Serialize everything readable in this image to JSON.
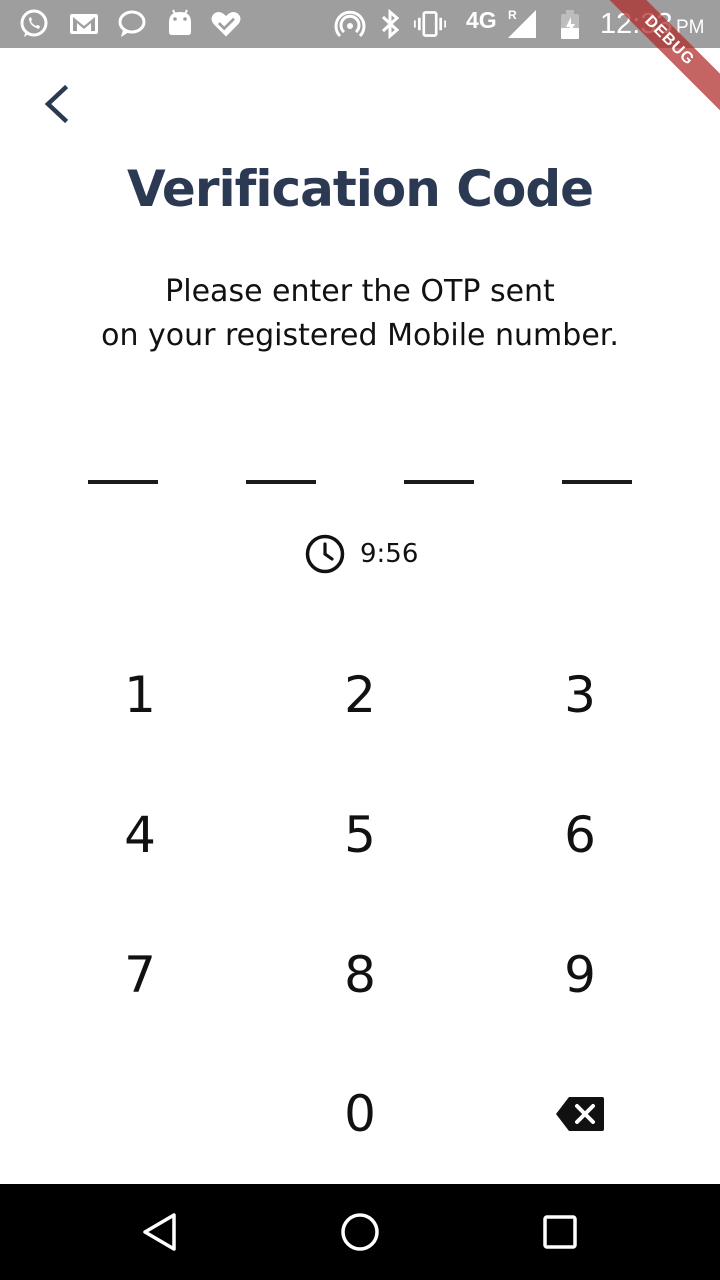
{
  "status_bar": {
    "network": "4G",
    "roaming": "R",
    "time": "12:33",
    "ampm": "PM",
    "debug_banner": "DEBUG",
    "icons": [
      "whatsapp-icon",
      "gmail-icon",
      "chat-bubble-icon",
      "android-icon",
      "heart-check-icon",
      "hotspot-icon",
      "bluetooth-icon",
      "vibrate-icon",
      "signal-icon",
      "battery-icon"
    ],
    "bar_color": "#9e9e9e"
  },
  "header": {
    "back_icon": "chevron-left-icon",
    "title": "Verification Code",
    "title_color": "#2b3a52"
  },
  "instructions": {
    "line1": "Please enter the OTP sent",
    "line2": "on your registered Mobile number."
  },
  "otp": {
    "digits": [
      "",
      "",
      "",
      ""
    ]
  },
  "timer": {
    "icon": "clock-icon",
    "remaining": "9:56"
  },
  "keypad": {
    "keys": [
      "1",
      "2",
      "3",
      "4",
      "5",
      "6",
      "7",
      "8",
      "9",
      "0"
    ],
    "backspace_icon": "backspace-icon"
  },
  "nav_bar": {
    "icons": [
      "back-triangle-icon",
      "home-circle-icon",
      "recents-square-icon"
    ]
  }
}
